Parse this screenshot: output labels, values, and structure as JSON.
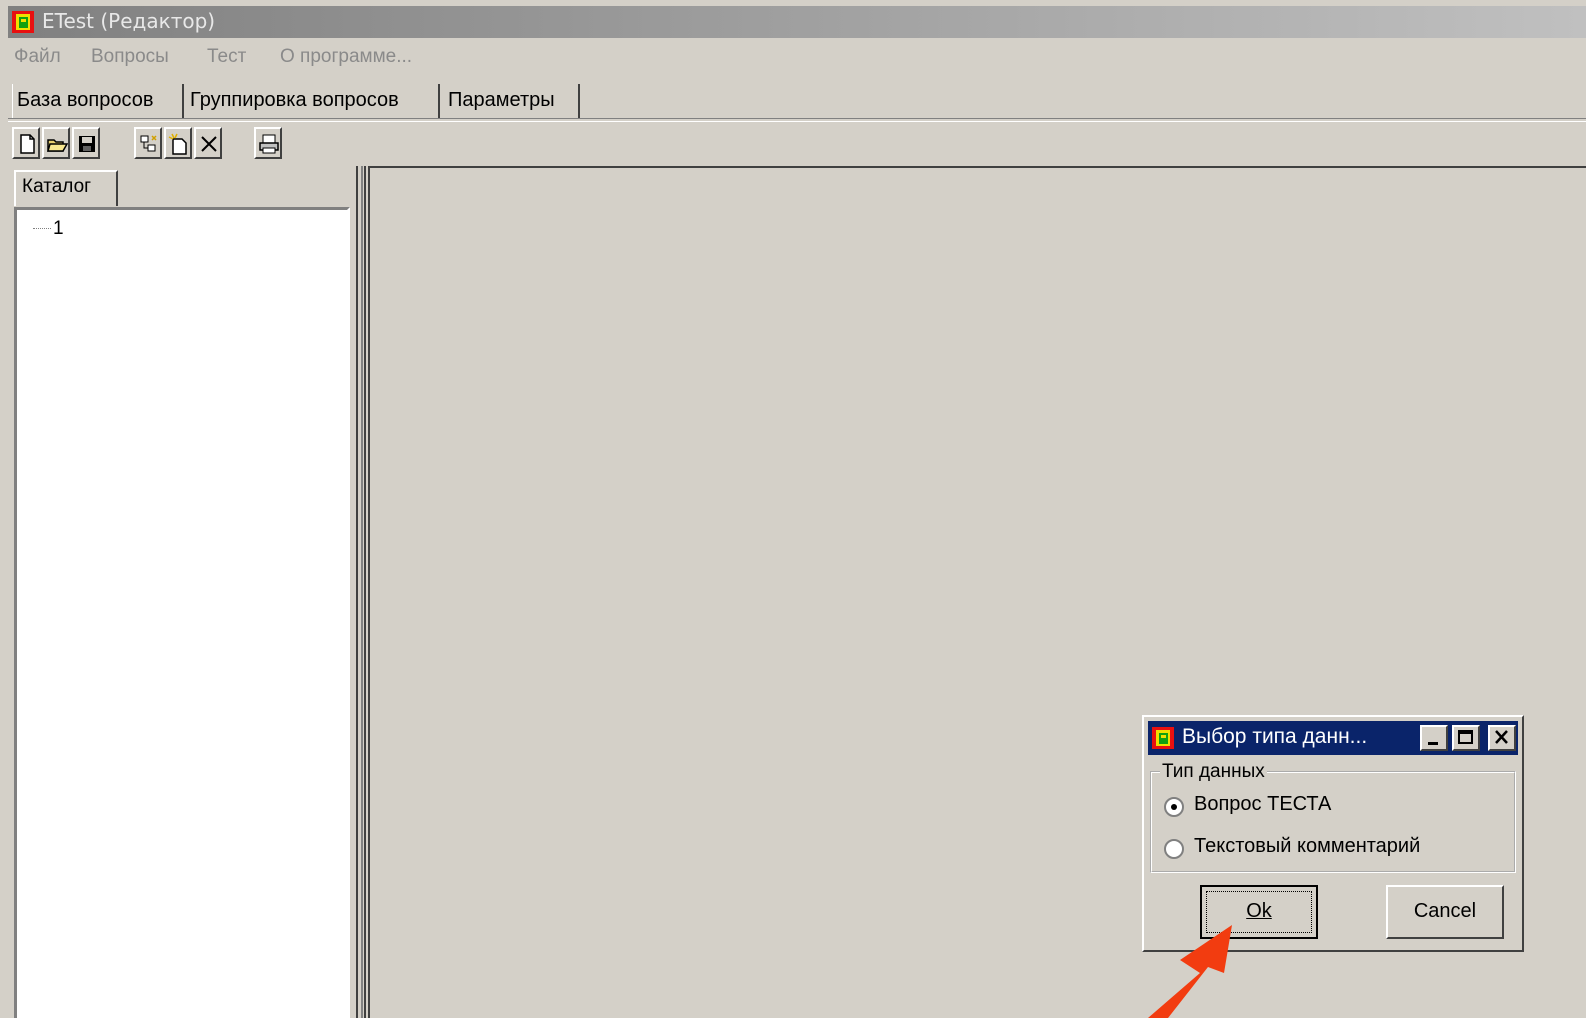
{
  "window": {
    "title": "ETest (Редактор)"
  },
  "menu": [
    "Файл",
    "Вопросы",
    "Тест",
    "О программе..."
  ],
  "tabs": [
    "База вопросов",
    "Группировка вопросов",
    "Параметры"
  ],
  "toolbar": {
    "buttons": [
      "new-icon",
      "open-folder-icon",
      "save-icon",
      "tree-add-icon",
      "new-item-icon",
      "delete-icon",
      "print-icon"
    ]
  },
  "catalog": {
    "tab_label": "Каталог",
    "tree_item": "1"
  },
  "dialog": {
    "title": "Выбор типа данн...",
    "group_label": "Тип данных",
    "options": [
      "Вопрос ТЕСТА",
      "Текстовый комментарий"
    ],
    "selected_option": "Вопрос ТЕСТА",
    "ok_label": "Ok",
    "cancel_label": "Cancel"
  },
  "colors": {
    "window_bg": "#d4d0c8",
    "active_title": "#0a246a",
    "annotation_arrow": "#f23c10"
  }
}
